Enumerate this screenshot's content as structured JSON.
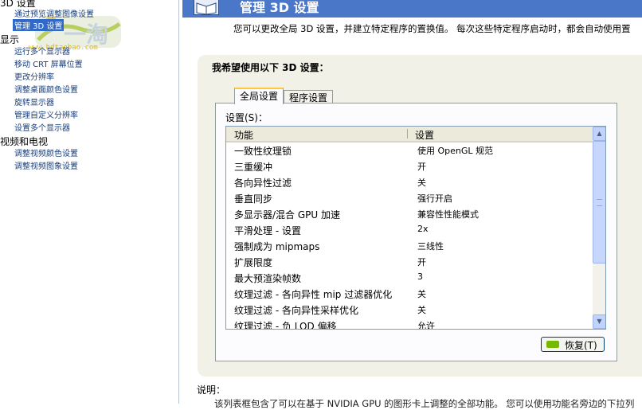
{
  "sidebar": {
    "categories": [
      "3D 设置",
      "显示",
      "视频和电视"
    ],
    "items_3d": [
      "通过预览调整图像设置",
      "管理 3D 设置"
    ],
    "items_display": [
      "运行多个显示器",
      "移动 CRT 屏幕位置",
      "更改分辨率",
      "调整桌面颜色设置",
      "旋转显示器",
      "管理自定义分辨率",
      "设置多个显示器"
    ],
    "items_video": [
      "调整视频颜色设置",
      "调整视频图象设置"
    ],
    "watermark_site": "www.hdtaobao.com"
  },
  "main": {
    "banner_title": "管理 3D 设置",
    "intro": "您可以更改全局 3D 设置，并建立特定程序的置换值。 每次这些特定程序启动时，都会自动使用置",
    "panel_title": "我希望使用以下 3D 设置：",
    "tabs": [
      "全局设置",
      "程序设置"
    ],
    "settings_label": "设置(S)：",
    "columns": [
      "功能",
      "设置"
    ],
    "rows": [
      {
        "feature": "一致性纹理锁",
        "value": "使用 OpenGL 规范"
      },
      {
        "feature": "三重缓冲",
        "value": "开"
      },
      {
        "feature": "各向异性过滤",
        "value": "关"
      },
      {
        "feature": "垂直同步",
        "value": "强行开启"
      },
      {
        "feature": "多显示器/混合 GPU 加速",
        "value": "兼容性性能模式"
      },
      {
        "feature": "平滑处理 - 设置",
        "value": "2x"
      },
      {
        "feature": "强制成为 mipmaps",
        "value": "三线性"
      },
      {
        "feature": "扩展限度",
        "value": "开"
      },
      {
        "feature": "最大预渲染帧数",
        "value": "3"
      },
      {
        "feature": "纹理过滤 - 各向异性 mip 过滤器优化",
        "value": "关"
      },
      {
        "feature": "纹理过滤 - 各向异性采样优化",
        "value": "关"
      },
      {
        "feature": "纹理过滤 - 负 LOD 偏移",
        "value": "允许"
      }
    ],
    "restore_label": "恢复(T)",
    "desc_label": "说明：",
    "desc_text": "该列表框包含了可以在基于 NVIDIA GPU 的图形卡上调整的全部功能。 您可以使用功能名旁边的下拉列"
  },
  "colors": {
    "nav_selected": "#3169c6",
    "banner": "#4b77c8",
    "nvidia_green": "#76b900"
  }
}
